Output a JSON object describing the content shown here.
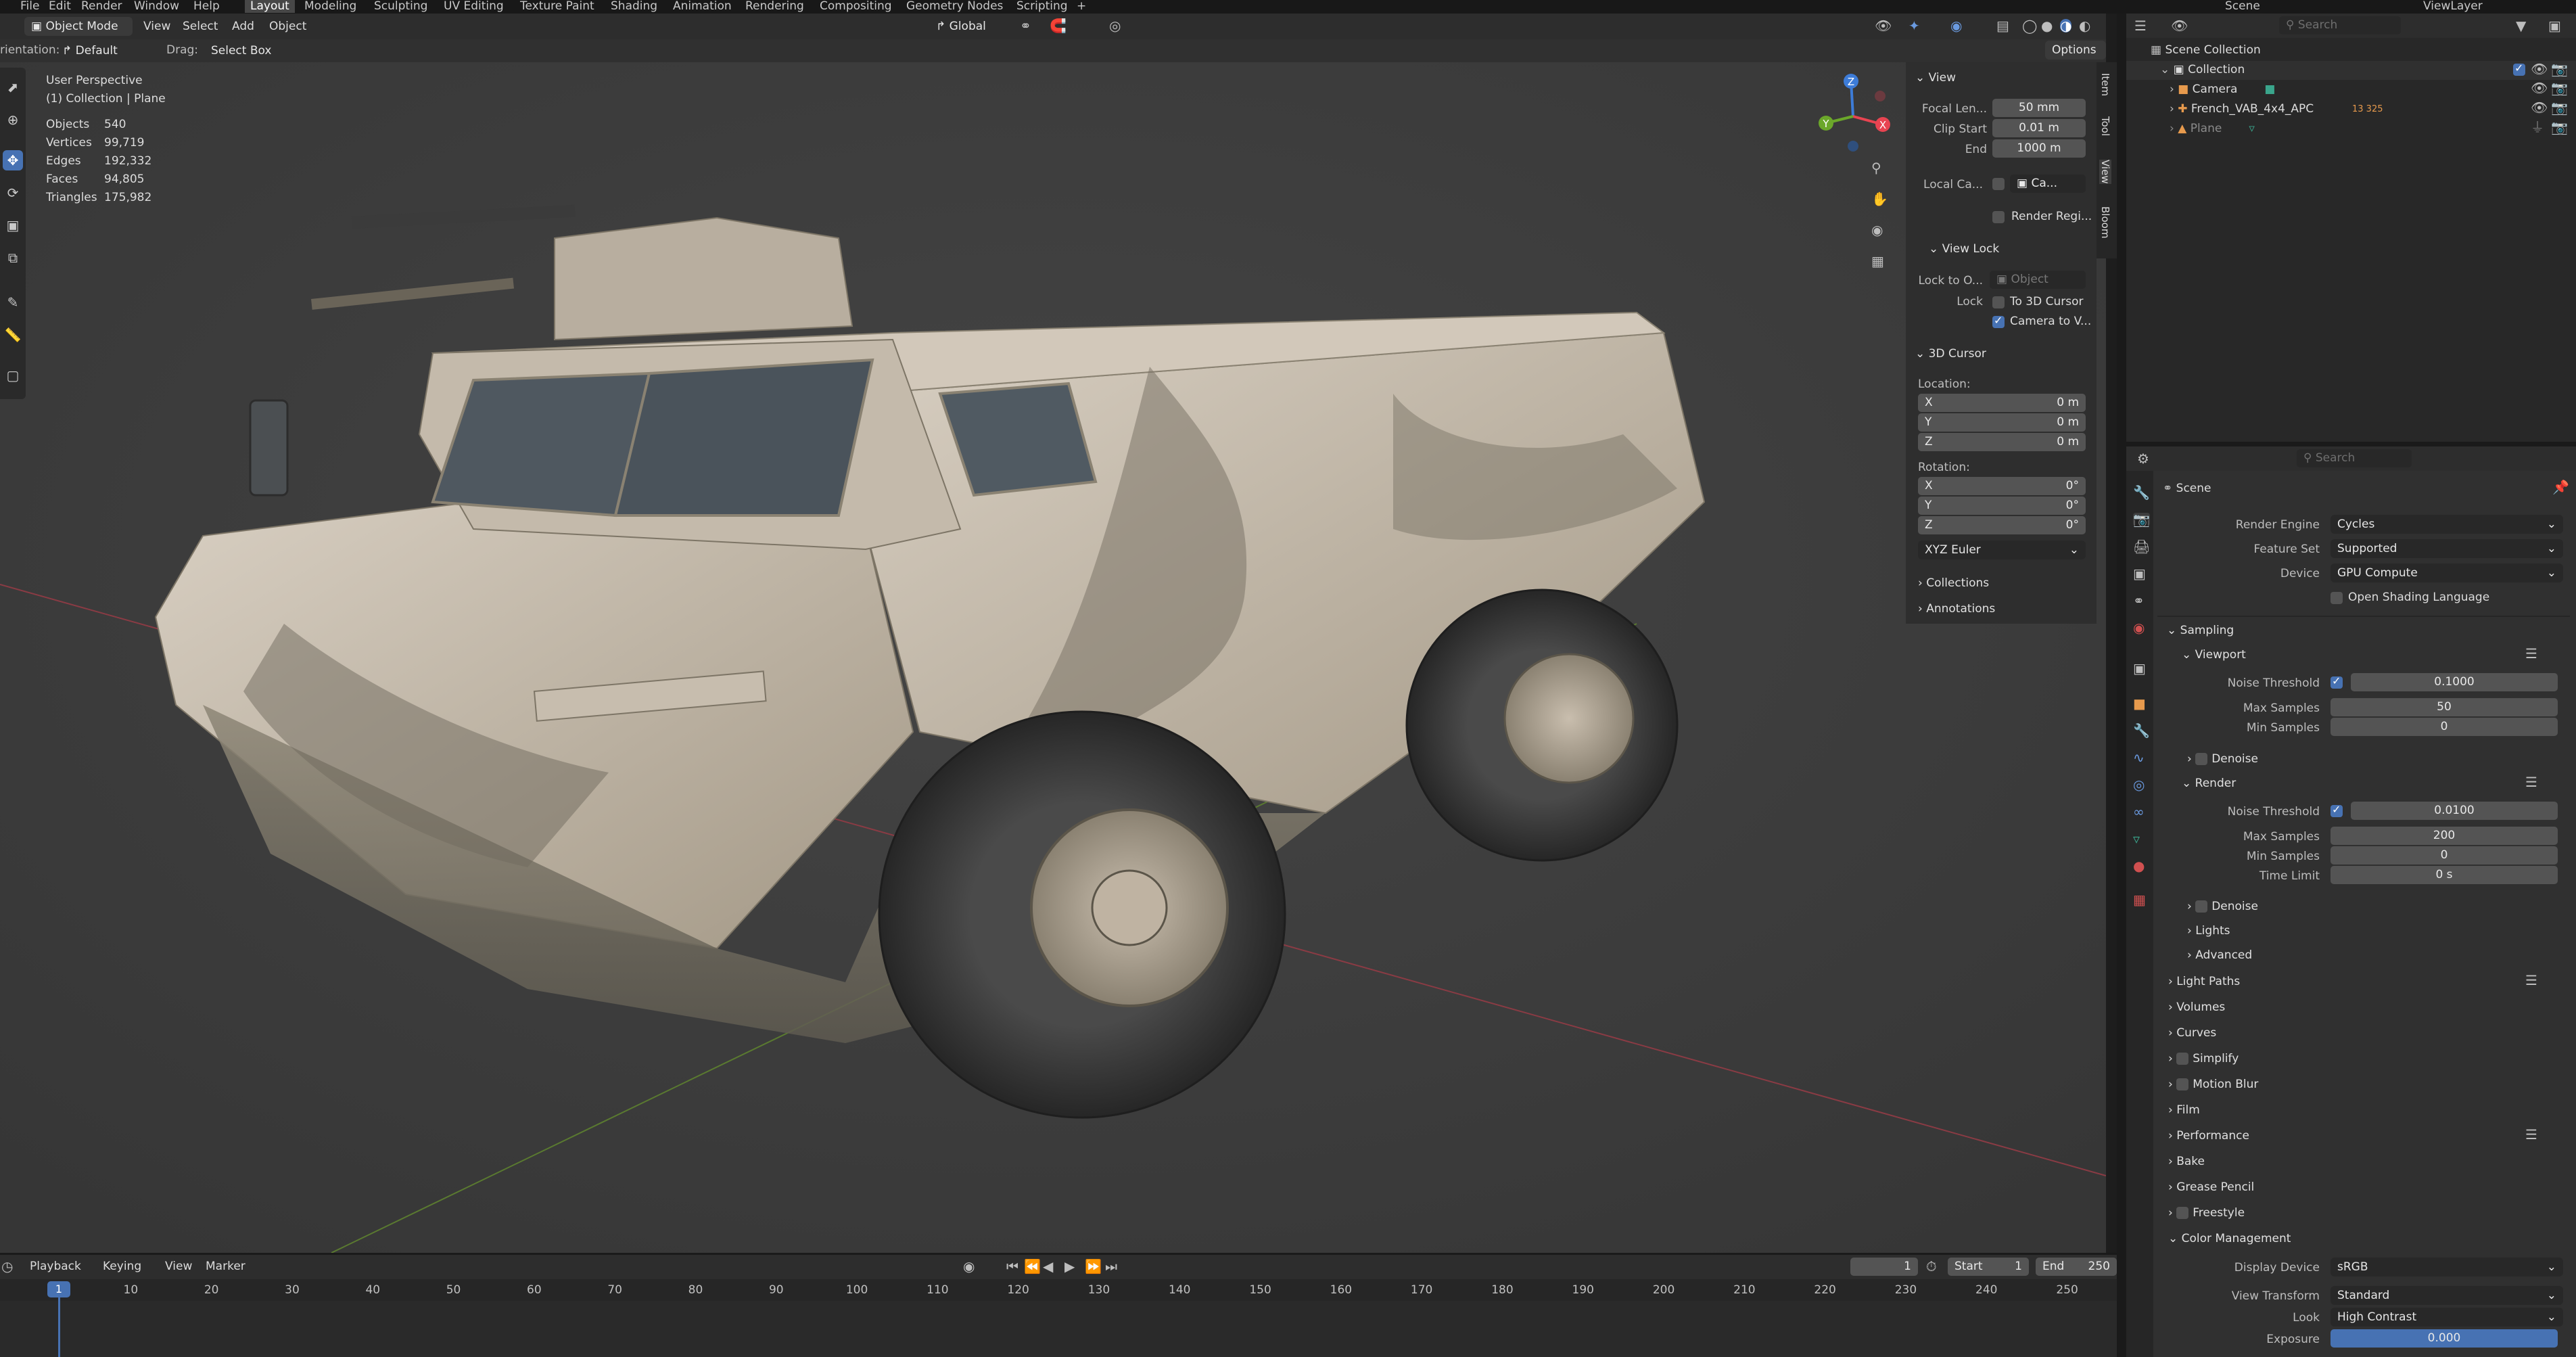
{
  "top_menu": {
    "items": [
      "File",
      "Edit",
      "Render",
      "Window",
      "Help"
    ],
    "workspaces": [
      "Layout",
      "Modeling",
      "Sculpting",
      "UV Editing",
      "Texture Paint",
      "Shading",
      "Animation",
      "Rendering",
      "Compositing",
      "Geometry Nodes",
      "Scripting"
    ],
    "add_tab": "+",
    "scene": "Scene",
    "view_layer": "ViewLayer"
  },
  "viewport_header": {
    "mode": "Object Mode",
    "menus": [
      "View",
      "Select",
      "Add",
      "Object"
    ],
    "transform_orientation": "Global"
  },
  "tool_header": {
    "orientation_label": "rientation:",
    "orientation_value": "Default",
    "drag_label": "Drag:",
    "drag_value": "Select Box",
    "options": "Options"
  },
  "viewport_overlay": {
    "view_name": "User Perspective",
    "context": "(1) Collection | Plane",
    "stats": [
      {
        "label": "Objects",
        "value": "540"
      },
      {
        "label": "Vertices",
        "value": "99,719"
      },
      {
        "label": "Edges",
        "value": "192,332"
      },
      {
        "label": "Faces",
        "value": "94,805"
      },
      {
        "label": "Triangles",
        "value": "175,982"
      }
    ],
    "gizmo_axes": {
      "x": "X",
      "y": "Y",
      "z": "Z"
    }
  },
  "sidebar_tabs": [
    "Item",
    "Tool",
    "View",
    "Bloom"
  ],
  "view_panel": {
    "title": "View",
    "focal_label": "Focal Len...",
    "focal_value": "50 mm",
    "clip_start_label": "Clip Start",
    "clip_start_value": "0.01 m",
    "clip_end_label": "End",
    "clip_end_value": "1000 m",
    "local_camera_label": "Local Ca...",
    "local_camera_value": "Ca...",
    "render_region": "Render Regi...",
    "view_lock_title": "View Lock",
    "lock_to_label": "Lock to O...",
    "lock_to_placeholder": "Object",
    "lock_label": "Lock",
    "to_cursor": "To 3D Cursor",
    "camera_to_view": "Camera to V..."
  },
  "cursor_panel": {
    "title": "3D Cursor",
    "location_label": "Location:",
    "location": [
      {
        "axis": "X",
        "value": "0 m"
      },
      {
        "axis": "Y",
        "value": "0 m"
      },
      {
        "axis": "Z",
        "value": "0 m"
      }
    ],
    "rotation_label": "Rotation:",
    "rotation": [
      {
        "axis": "X",
        "value": "0°"
      },
      {
        "axis": "Y",
        "value": "0°"
      },
      {
        "axis": "Z",
        "value": "0°"
      }
    ],
    "rotation_mode": "XYZ Euler",
    "collections": "Collections",
    "annotations": "Annotations"
  },
  "outliner": {
    "search_placeholder": "Search",
    "root": "Scene Collection",
    "collection": "Collection",
    "items": [
      "Camera",
      "French_VAB_4x4_APC",
      "Plane"
    ],
    "apc_count": "13 325"
  },
  "properties": {
    "search_placeholder": "Search",
    "context": "Scene",
    "render_engine_label": "Render Engine",
    "render_engine": "Cycles",
    "feature_set_label": "Feature Set",
    "feature_set": "Supported",
    "device_label": "Device",
    "device": "GPU Compute",
    "osl": "Open Shading Language",
    "sampling": "Sampling",
    "viewport": "Viewport",
    "noise_threshold_label": "Noise Threshold",
    "vp_noise": "0.1000",
    "max_samples_label": "Max Samples",
    "vp_max": "50",
    "min_samples_label": "Min Samples",
    "vp_min": "0",
    "denoise": "Denoise",
    "render": "Render",
    "r_noise": "0.0100",
    "r_max": "200",
    "r_min": "0",
    "time_limit_label": "Time Limit",
    "time_limit": "0 s",
    "lights": "Lights",
    "advanced": "Advanced",
    "sections": [
      "Light Paths",
      "Volumes",
      "Curves",
      "Simplify",
      "Motion Blur",
      "Film",
      "Performance",
      "Bake",
      "Grease Pencil",
      "Freestyle",
      "Color Management"
    ],
    "display_device_label": "Display Device",
    "display_device": "sRGB",
    "view_transform_label": "View Transform",
    "view_transform": "Standard",
    "look_label": "Look",
    "look": "High Contrast",
    "exposure_label": "Exposure",
    "exposure": "0.000"
  },
  "timeline": {
    "menus": [
      "Playback",
      "Keying",
      "View",
      "Marker"
    ],
    "current_frame": "1",
    "start_label": "Start",
    "start": "1",
    "end_label": "End",
    "end": "250",
    "ticks": [
      "10",
      "20",
      "30",
      "40",
      "50",
      "60",
      "70",
      "80",
      "90",
      "100",
      "110",
      "120",
      "130",
      "140",
      "150",
      "160",
      "170",
      "180",
      "190",
      "200",
      "210",
      "220",
      "230",
      "240",
      "250"
    ],
    "playhead": "1"
  },
  "colors": {
    "accent": "#4772b3",
    "axis_x": "#e84451",
    "axis_y": "#6ba72a",
    "axis_z": "#3d7cd8"
  }
}
